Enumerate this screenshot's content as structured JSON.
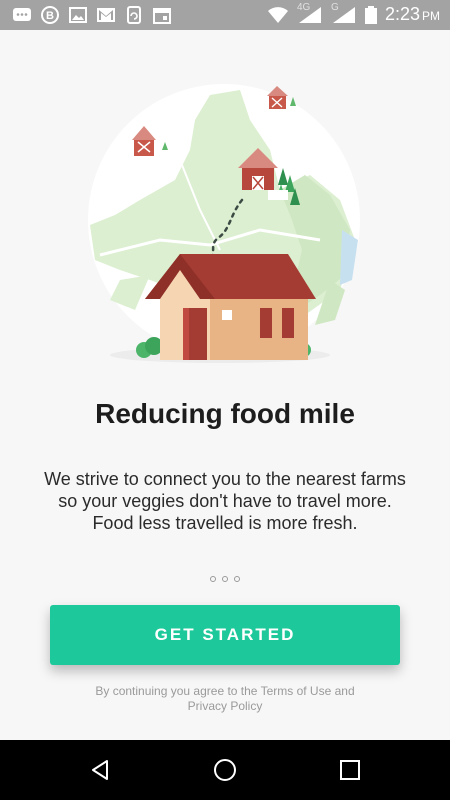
{
  "status_bar": {
    "time": "2:23",
    "time_suffix": "PM",
    "network_4g": "4G",
    "network_g": "G",
    "left_icons": [
      "message-icon",
      "b-notification-icon",
      "image-icon",
      "gmail-icon",
      "sync-icon",
      "calendar-icon"
    ],
    "right_icons": [
      "wifi-icon",
      "signal-4g-icon",
      "signal-g-icon",
      "battery-icon"
    ]
  },
  "onboarding": {
    "title": "Reducing food mile",
    "description": "We strive to connect you to the nearest farms so your veggies don't have to travel more. Food less travelled is more fresh.",
    "pager": {
      "total_pages": 3,
      "current_page": 1
    },
    "cta_label": "GET STARTED",
    "terms": "By continuing you agree to the Terms of Use and Privacy Policy"
  },
  "nav_bar": {
    "icons": [
      "back-icon",
      "home-icon",
      "recents-icon"
    ]
  },
  "colors": {
    "accent": "#1dc99b",
    "status_bar": "#a3a3a3",
    "nav_bar": "#000000",
    "house_roof": "#a43c33",
    "house_wall": "#f6d6b2",
    "map_green": "#dcefd1"
  }
}
